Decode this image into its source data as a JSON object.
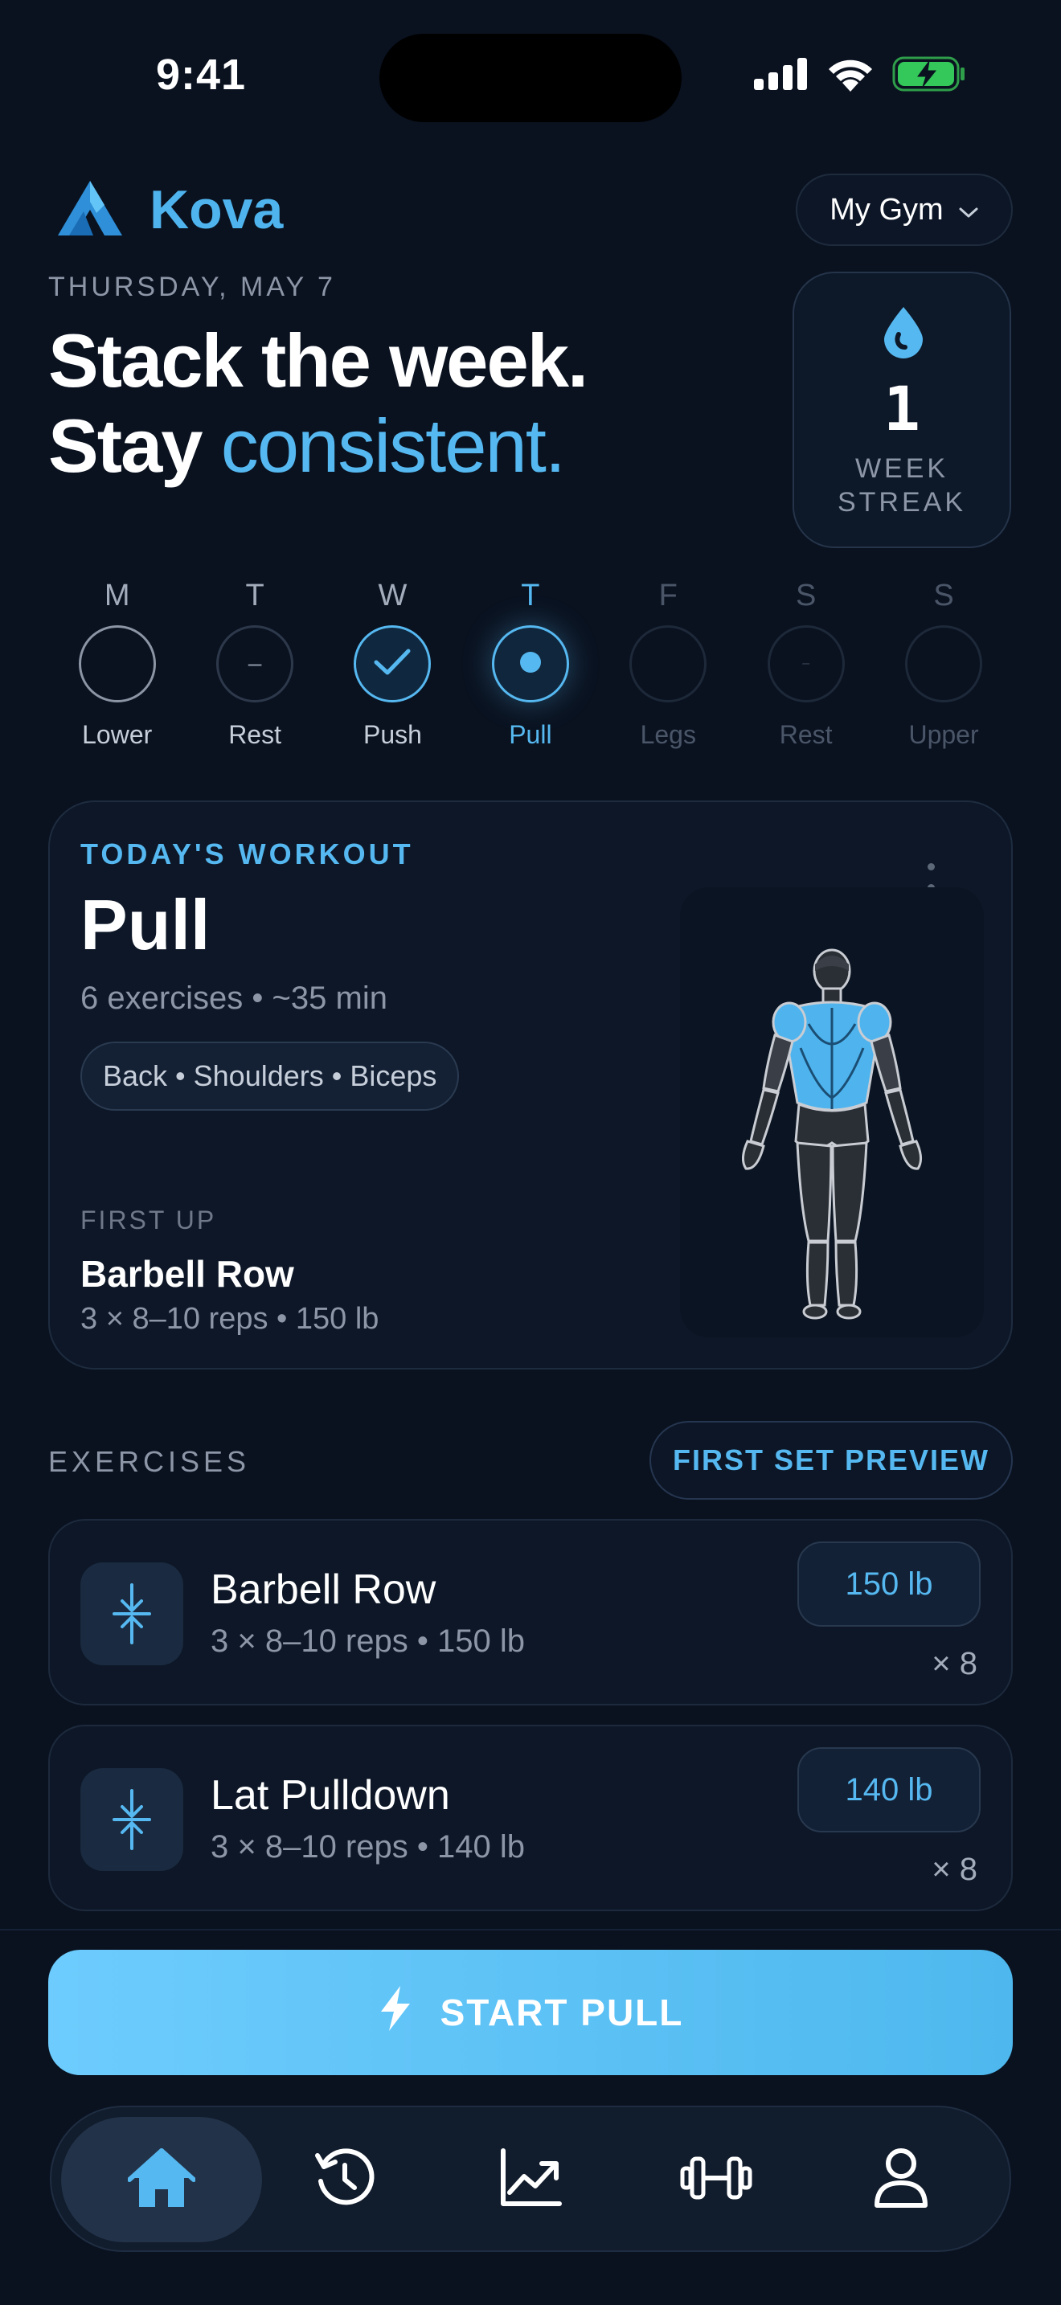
{
  "status_bar": {
    "time": "9:41"
  },
  "header": {
    "brand": "Kova",
    "gym_select": "My Gym",
    "date": "THURSDAY, MAY 7",
    "headline_line1": "Stack the week.",
    "headline_line2_plain": "Stay",
    "headline_line2_accent": "consistent."
  },
  "streak": {
    "value": "1",
    "label_line1": "WEEK",
    "label_line2": "STREAK"
  },
  "week": [
    {
      "letter": "M",
      "label": "Lower",
      "state": "open"
    },
    {
      "letter": "T",
      "label": "Rest",
      "state": "rest",
      "mark": "–"
    },
    {
      "letter": "W",
      "label": "Push",
      "state": "done"
    },
    {
      "letter": "T",
      "label": "Pull",
      "state": "today"
    },
    {
      "letter": "F",
      "label": "Legs",
      "state": "future"
    },
    {
      "letter": "S",
      "label": "Rest",
      "state": "future-rest",
      "mark": "–"
    },
    {
      "letter": "S",
      "label": "Upper",
      "state": "future"
    }
  ],
  "today_workout": {
    "kicker": "TODAY'S WORKOUT",
    "title": "Pull",
    "meta": "6 exercises • ~35 min",
    "muscles": "Back • Shoulders • Biceps",
    "first_up_label": "FIRST UP",
    "first_up_name": "Barbell Row",
    "first_up_meta": "3 × 8–10 reps • 150 lb"
  },
  "exercises": {
    "heading": "EXERCISES",
    "preview_button": "FIRST SET PREVIEW",
    "items": [
      {
        "name": "Barbell Row",
        "meta": "3 × 8–10 reps • 150 lb",
        "weight": "150 lb",
        "reps": "× 8"
      },
      {
        "name": "Lat Pulldown",
        "meta": "3 × 8–10 reps • 140 lb",
        "weight": "140 lb",
        "reps": "× 8"
      }
    ]
  },
  "start_button": "START PULL",
  "tabs": [
    {
      "icon": "home-icon",
      "active": true
    },
    {
      "icon": "history-icon",
      "active": false
    },
    {
      "icon": "progress-chart-icon",
      "active": false
    },
    {
      "icon": "dumbbell-icon",
      "active": false
    },
    {
      "icon": "profile-icon",
      "active": false
    }
  ],
  "colors": {
    "accent": "#56b8f0",
    "background": "#0a1220",
    "card": "#0d1727"
  }
}
